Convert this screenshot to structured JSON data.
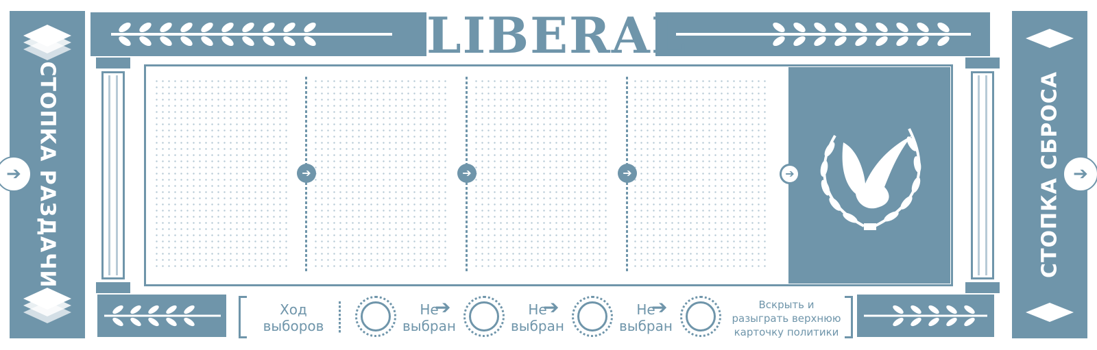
{
  "board": {
    "title": "LIBERAL",
    "left_pile_label": "СТОПКА РАЗДАЧИ",
    "right_pile_label": "СТОПКА СБРОСА",
    "left_arrow_icon": "arrow-left",
    "right_arrow_icon": "arrow-right"
  },
  "policy_track": {
    "slots": 5,
    "filled": 0,
    "emblem_icon": "dove-with-laurel-wreath"
  },
  "election_tracker": {
    "title": "Ход выборов",
    "steps": [
      {
        "label": "Не выбран"
      },
      {
        "label": "Не выбран"
      },
      {
        "label": "Не выбран"
      }
    ],
    "final": "Вскрыть и разыграть верхнюю карточку политики",
    "marker_position": 0
  },
  "colors": {
    "primary": "#6f95aa",
    "light": "#b7cad6",
    "background": "#ffffff"
  }
}
